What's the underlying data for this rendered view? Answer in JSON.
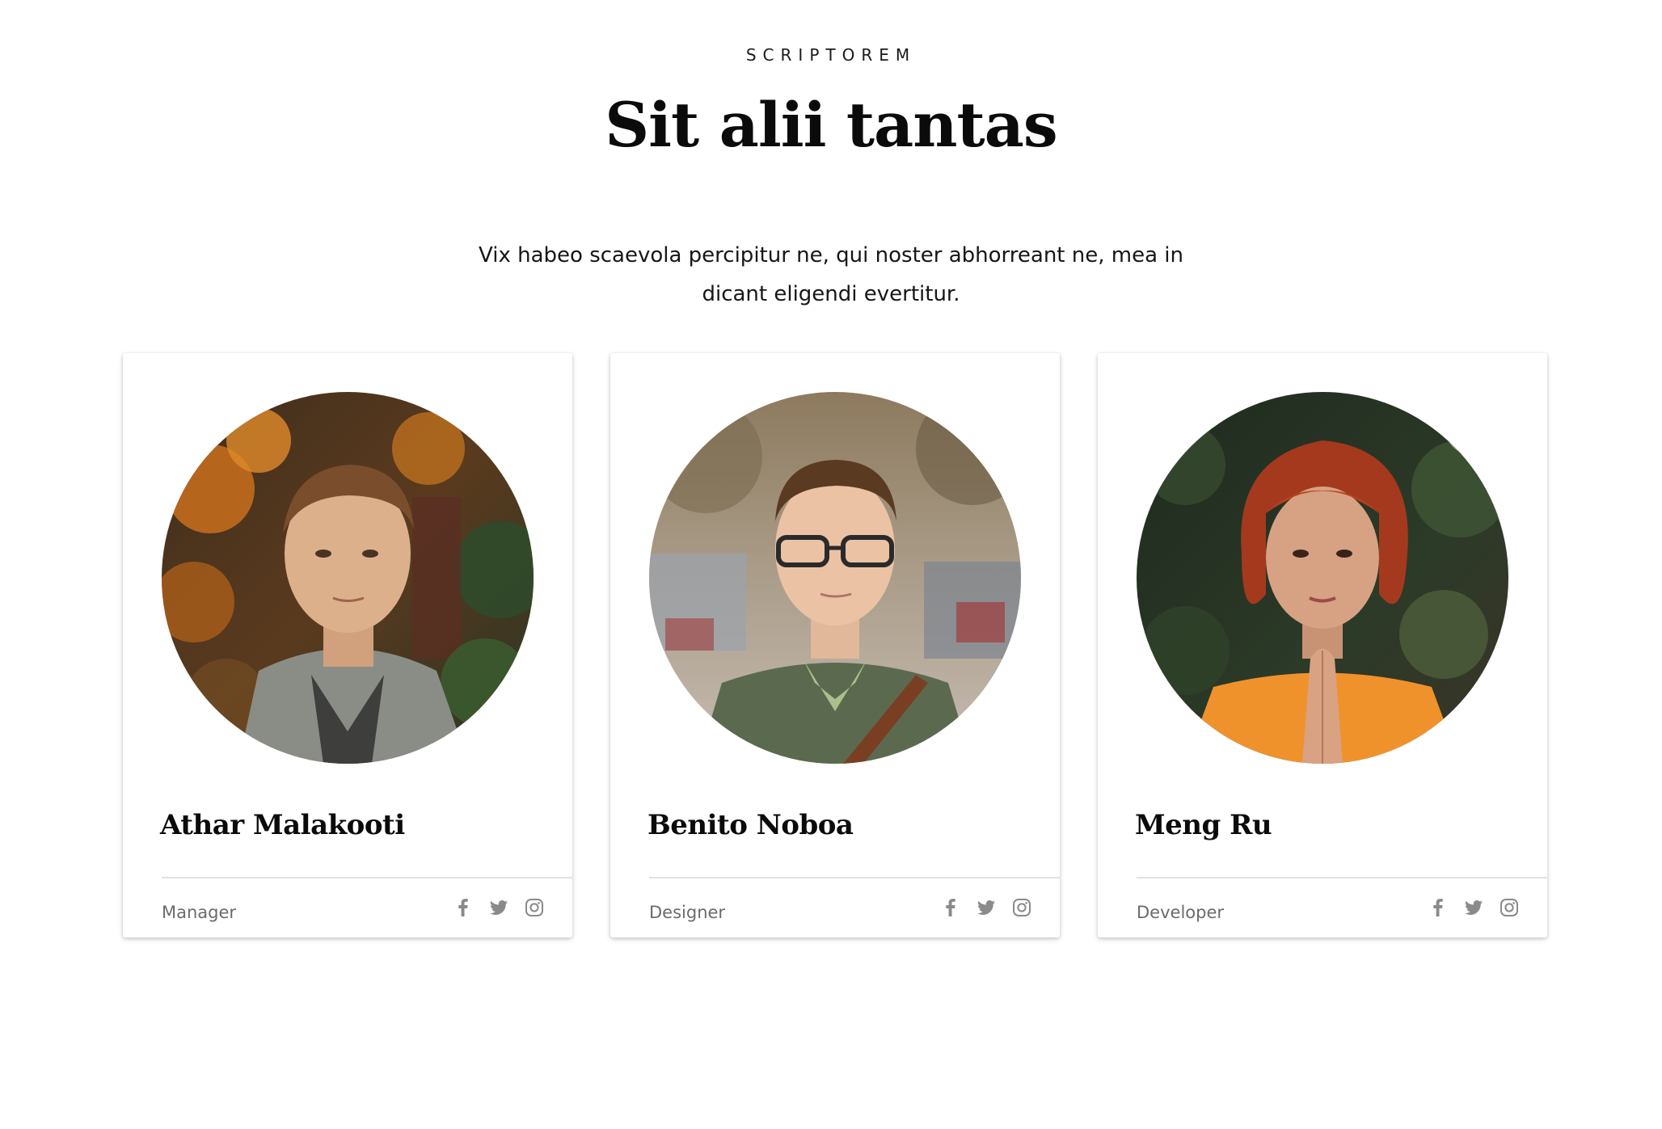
{
  "header": {
    "eyebrow": "SCRIPTOREM",
    "title": "Sit alii tantas",
    "intro": "Vix habeo scaevola percipitur ne, qui noster abhorreant ne, mea in dicant eligendi evertitur."
  },
  "team": [
    {
      "name": "Athar Malakooti",
      "role": "Manager",
      "photo": "portrait of man in grey blazer with autumn foliage",
      "socials": [
        "facebook-icon",
        "twitter-icon",
        "instagram-icon"
      ]
    },
    {
      "name": "Benito Noboa",
      "role": "Designer",
      "photo": "portrait of man with glasses and green sweater on street",
      "socials": [
        "facebook-icon",
        "twitter-icon",
        "instagram-icon"
      ]
    },
    {
      "name": "Meng Ru",
      "role": "Developer",
      "photo": "portrait of woman with red hair and orange jacket",
      "socials": [
        "facebook-icon",
        "twitter-icon",
        "instagram-icon"
      ]
    }
  ],
  "colors": {
    "text": "#111111",
    "muted": "#6b6b6b",
    "icon": "#8a8a8a",
    "divider": "#e2e2e2"
  }
}
